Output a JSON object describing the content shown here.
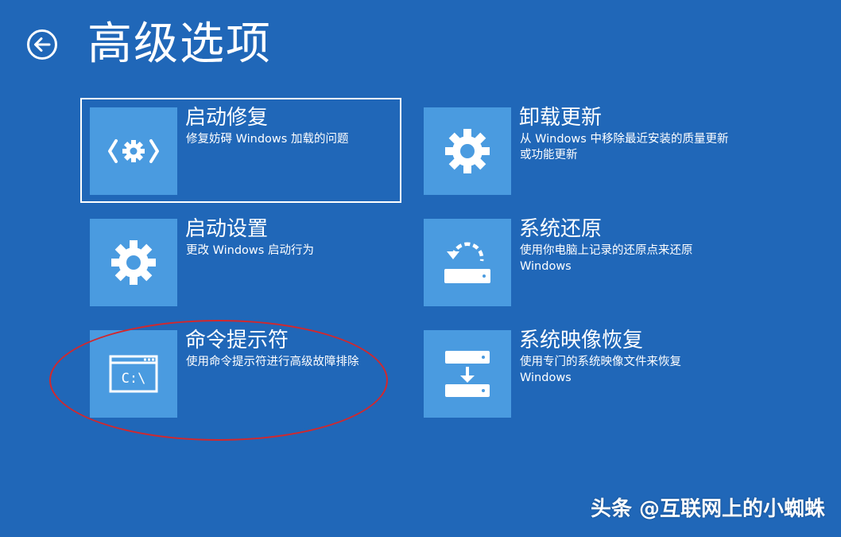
{
  "header": {
    "title": "高级选项",
    "back_icon": "back-arrow-circle-icon"
  },
  "options": [
    {
      "title": "启动修复",
      "desc": "修复妨碍 Windows 加载的问题",
      "icon": "startup-repair-icon",
      "selected": true
    },
    {
      "title": "卸载更新",
      "desc": "从 Windows 中移除最近安装的质量更新或功能更新",
      "icon": "gear-icon"
    },
    {
      "title": "启动设置",
      "desc": "更改 Windows 启动行为",
      "icon": "gear-icon"
    },
    {
      "title": "系统还原",
      "desc": "使用你电脑上记录的还原点来还原 Windows",
      "icon": "system-restore-icon"
    },
    {
      "title": "命令提示符",
      "desc": "使用命令提示符进行高级故障排除",
      "icon": "command-prompt-icon",
      "icon_text": "C:\\"
    },
    {
      "title": "系统映像恢复",
      "desc": "使用专门的系统映像文件来恢复 Windows",
      "icon": "system-image-recovery-icon"
    }
  ],
  "annotation": {
    "color": "#d2282d",
    "highlights": "命令提示符"
  },
  "watermark": "头条 @互联网上的小蜘蛛",
  "colors": {
    "background": "#2067b8",
    "tile": "#4a9be0",
    "text": "#ffffff"
  }
}
